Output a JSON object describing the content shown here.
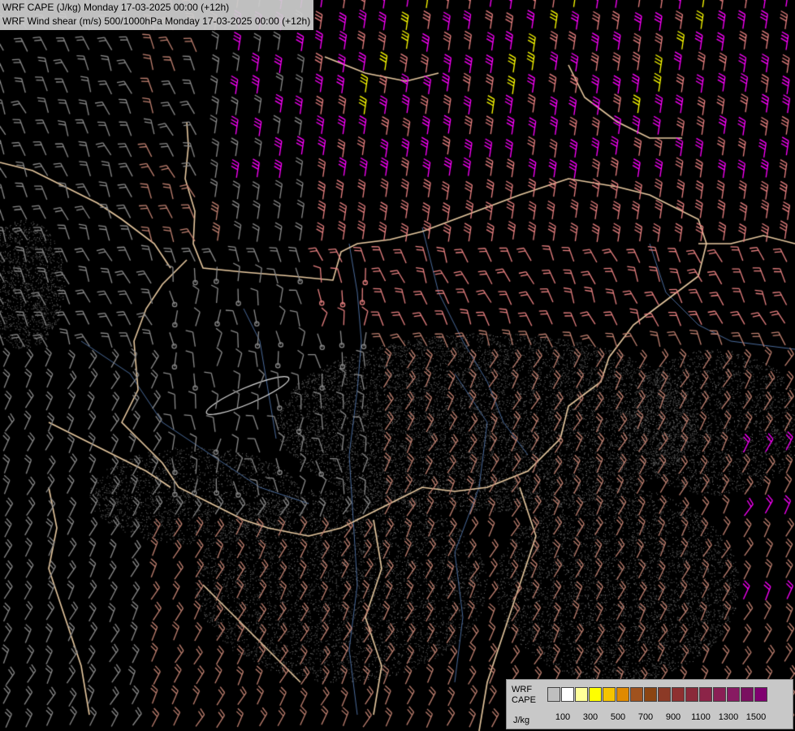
{
  "header": {
    "line1": "WRF CAPE (J/kg) Monday 17-03-2025 00:00 (+12h)",
    "line2": "WRF Wind shear (m/s) 500/1000hPa Monday 17-03-2025 00:00 (+12h)"
  },
  "legend": {
    "title_line1": "WRF",
    "title_line2": "CAPE",
    "unit": "J/kg",
    "tick_labels": [
      "100",
      "300",
      "500",
      "700",
      "900",
      "1100",
      "1300",
      "1500"
    ],
    "swatch_colors": [
      "#bfbfbf",
      "#ffffff",
      "#ffff99",
      "#ffff00",
      "#f5c400",
      "#e08a00",
      "#a0521e",
      "#8b4513",
      "#8c3a26",
      "#8e3030",
      "#8a2a3a",
      "#8c2448",
      "#8a1f55",
      "#881a62",
      "#7a1060",
      "#800070"
    ]
  },
  "map": {
    "colors": {
      "background": "#000000",
      "shear_low": "#8a8a8a",
      "shear_mid": "#c08070",
      "shear_high": "#e88080",
      "shear_very_high": "#ff00ff",
      "shear_extreme": "#ffff00",
      "borders": "#e8c9a0",
      "rivers": "#4a6a9a"
    }
  }
}
